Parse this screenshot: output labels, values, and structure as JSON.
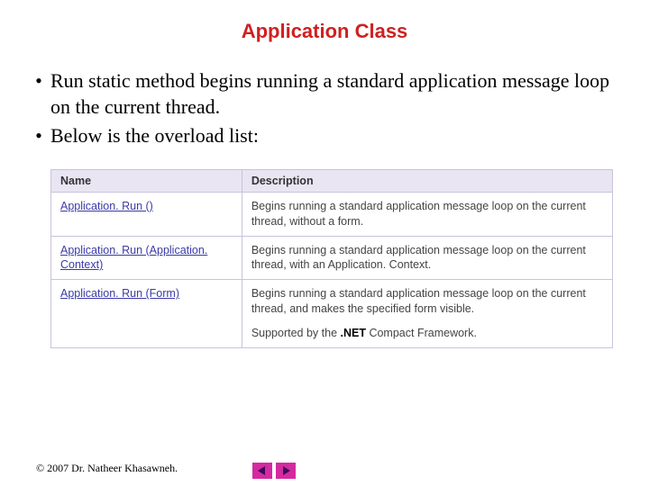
{
  "title": "Application Class",
  "bullets": [
    "Run static method begins running a standard application message loop on the current thread.",
    "Below is the overload list:"
  ],
  "table": {
    "headers": {
      "name": "Name",
      "desc": "Description"
    },
    "rows": [
      {
        "name": "Application. Run ()",
        "desc": "Begins running a standard application message loop on the current thread, without a form."
      },
      {
        "name": "Application. Run (Application. Context)",
        "desc": "Begins running a standard application message loop on the current thread, with an Application. Context."
      },
      {
        "name": "Application. Run (Form)",
        "desc": "Begins running a standard application message loop on the current thread, and makes the specified form visible.",
        "supported_prefix": "Supported by the ",
        "supported_bold": ".NET",
        "supported_suffix": " Compact Framework."
      }
    ]
  },
  "footer": "© 2007 Dr. Natheer Khasawneh."
}
